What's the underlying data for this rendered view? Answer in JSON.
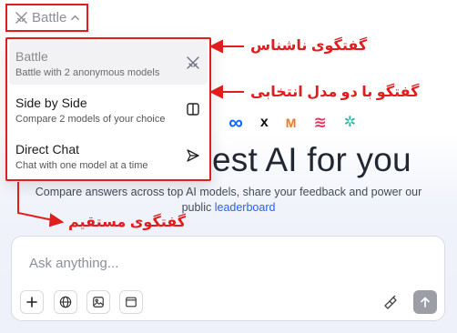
{
  "mode_selector": {
    "label": "Battle",
    "icon": "swords-icon",
    "chevron": "chevron-up-icon"
  },
  "dropdown": {
    "items": [
      {
        "title": "Battle",
        "subtitle": "Battle with 2 anonymous models",
        "icon": "swords-icon",
        "active": true
      },
      {
        "title": "Side by Side",
        "subtitle": "Compare 2 models of your choice",
        "icon": "columns-icon",
        "active": false
      },
      {
        "title": "Direct Chat",
        "subtitle": "Chat with one model at a time",
        "icon": "send-icon",
        "active": false
      }
    ]
  },
  "hero": {
    "title_visible": "est AI for you",
    "subtitle_line1": "Compare answers across top AI models, share your feedback and power our",
    "subtitle_line2_prefix": "public",
    "subtitle_link": "leaderboard"
  },
  "logos": {
    "items": [
      {
        "name": "anthropic-logo",
        "glyph": "\\",
        "color": "#111111"
      },
      {
        "name": "meta-logo",
        "glyph": "∞",
        "color": "#0866ff"
      },
      {
        "name": "xai-logo",
        "glyph": "x",
        "color": "#111111"
      },
      {
        "name": "mistral-logo",
        "glyph": "M",
        "color": "#f7751e"
      },
      {
        "name": "minimax-logo",
        "glyph": "≋",
        "color": "#e2365b"
      },
      {
        "name": "flower-logo",
        "glyph": "✲",
        "color": "#2bb5a3"
      }
    ]
  },
  "chat": {
    "placeholder": "Ask anything...",
    "tools": [
      "plus-icon",
      "globe-icon",
      "image-icon",
      "window-icon"
    ],
    "right_tool": "brush-icon",
    "send_icon": "arrow-up-icon"
  },
  "annotations": {
    "battle": "گفتگوی ناشناس",
    "side_by_side": "گفتگو با دو مدل انتخابی",
    "direct": "گفتگوی مستقیم",
    "color": "#e11d1d"
  }
}
